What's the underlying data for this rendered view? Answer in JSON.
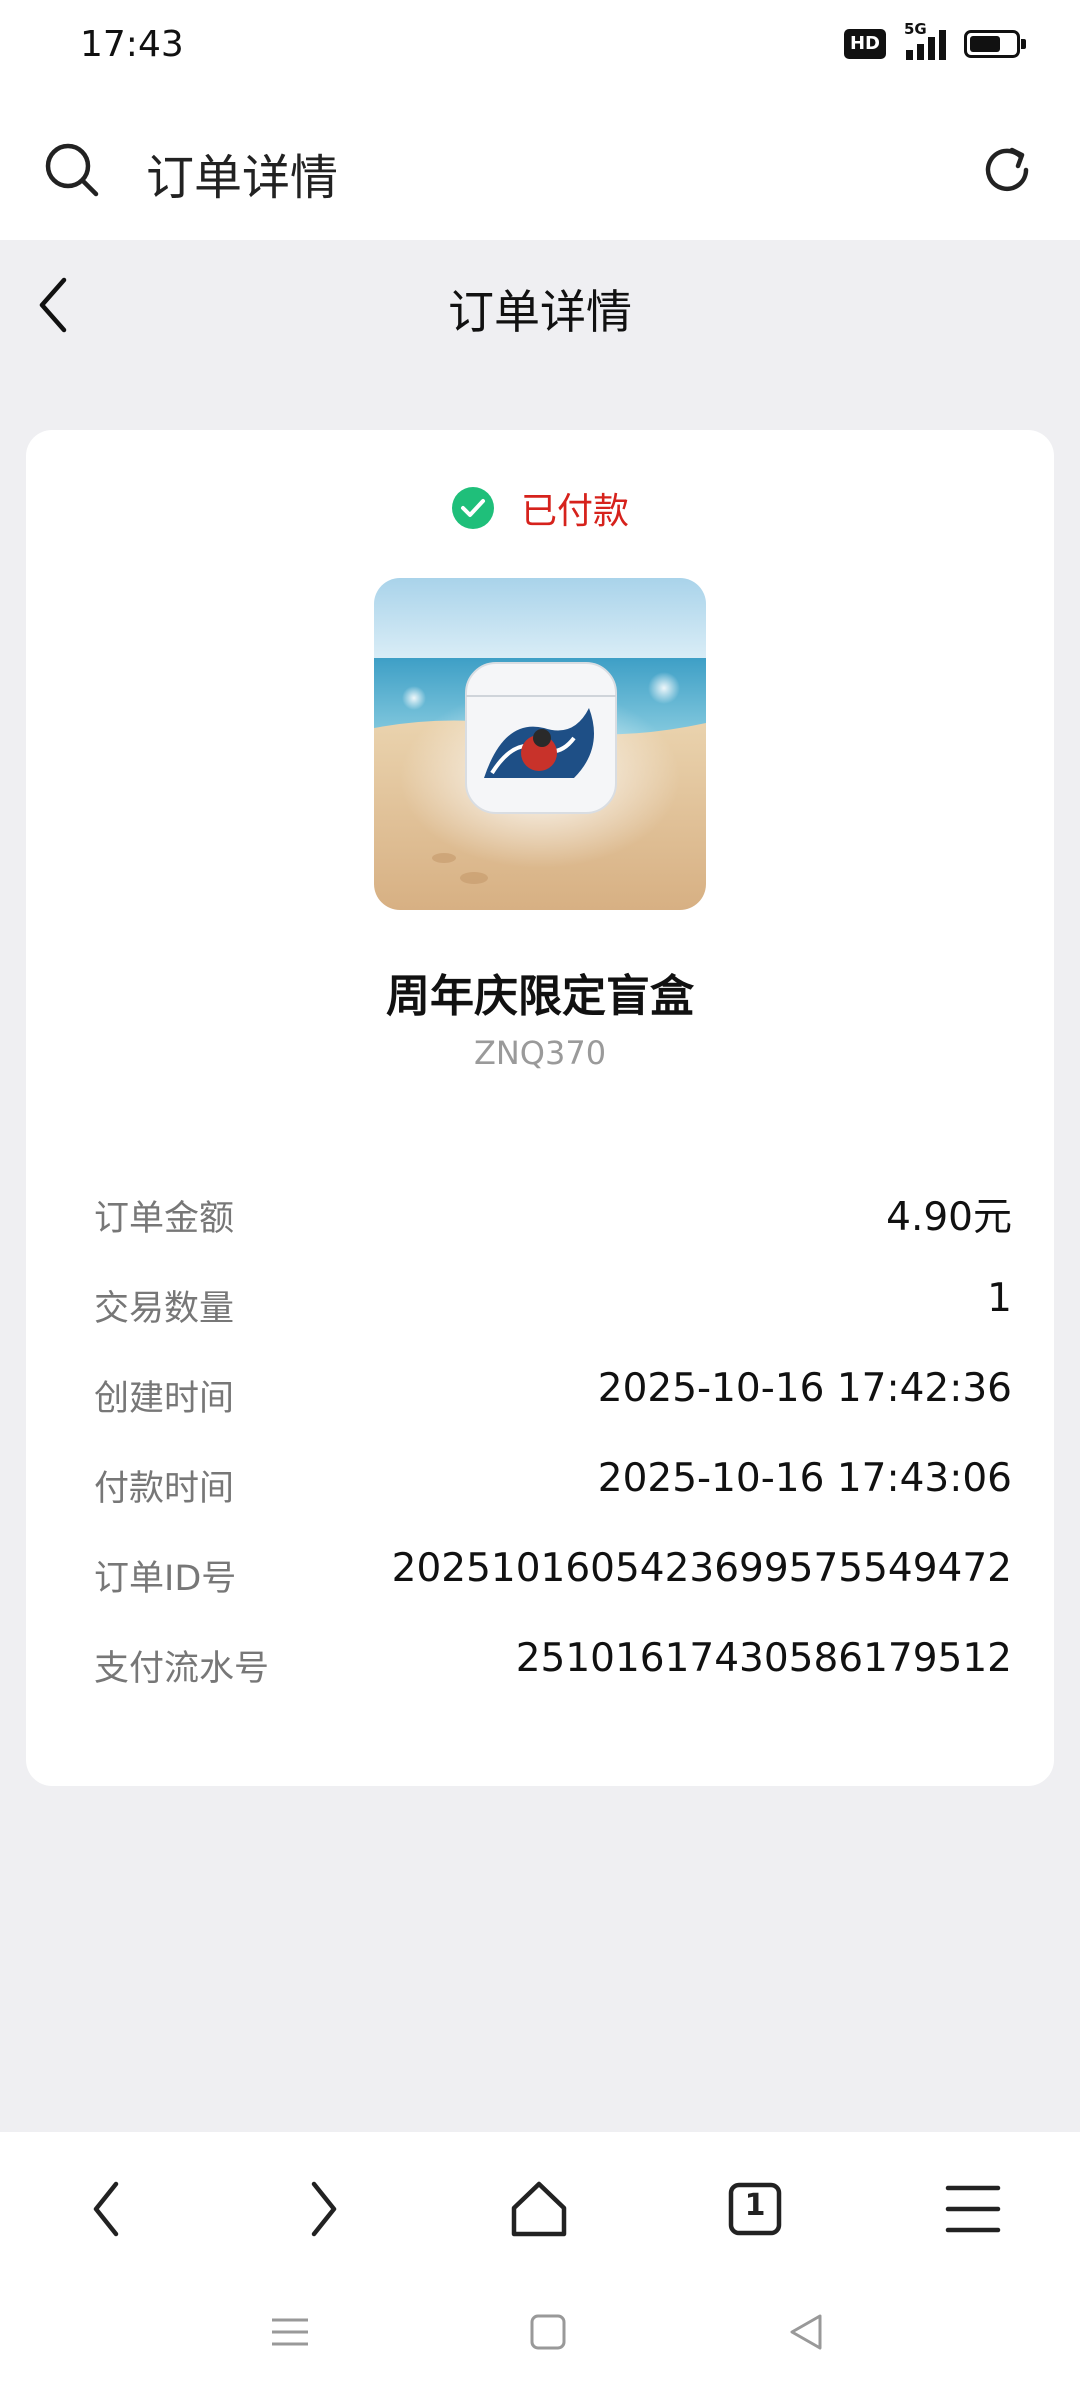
{
  "status_bar": {
    "time": "17:43",
    "hd": "HD",
    "network": "5G"
  },
  "browser": {
    "title": "订单详情"
  },
  "header": {
    "title": "订单详情"
  },
  "order": {
    "status": "已付款",
    "product_name": "周年庆限定盲盒",
    "product_code": "ZNQ370",
    "fields": [
      {
        "label": "订单金额",
        "value": "4.90元"
      },
      {
        "label": "交易数量",
        "value": "1"
      },
      {
        "label": "创建时间",
        "value": "2025-10-16 17:42:36"
      },
      {
        "label": "付款时间",
        "value": "2025-10-16 17:43:06"
      },
      {
        "label": "订单ID号",
        "value": "2025101605423699575549472"
      },
      {
        "label": "支付流水号",
        "value": "25101617430586179512"
      }
    ]
  },
  "nav": {
    "tab_count": "1"
  },
  "colors": {
    "paid_green": "#1fbf7a",
    "status_red": "#d6221c",
    "background": "#efeff2"
  }
}
